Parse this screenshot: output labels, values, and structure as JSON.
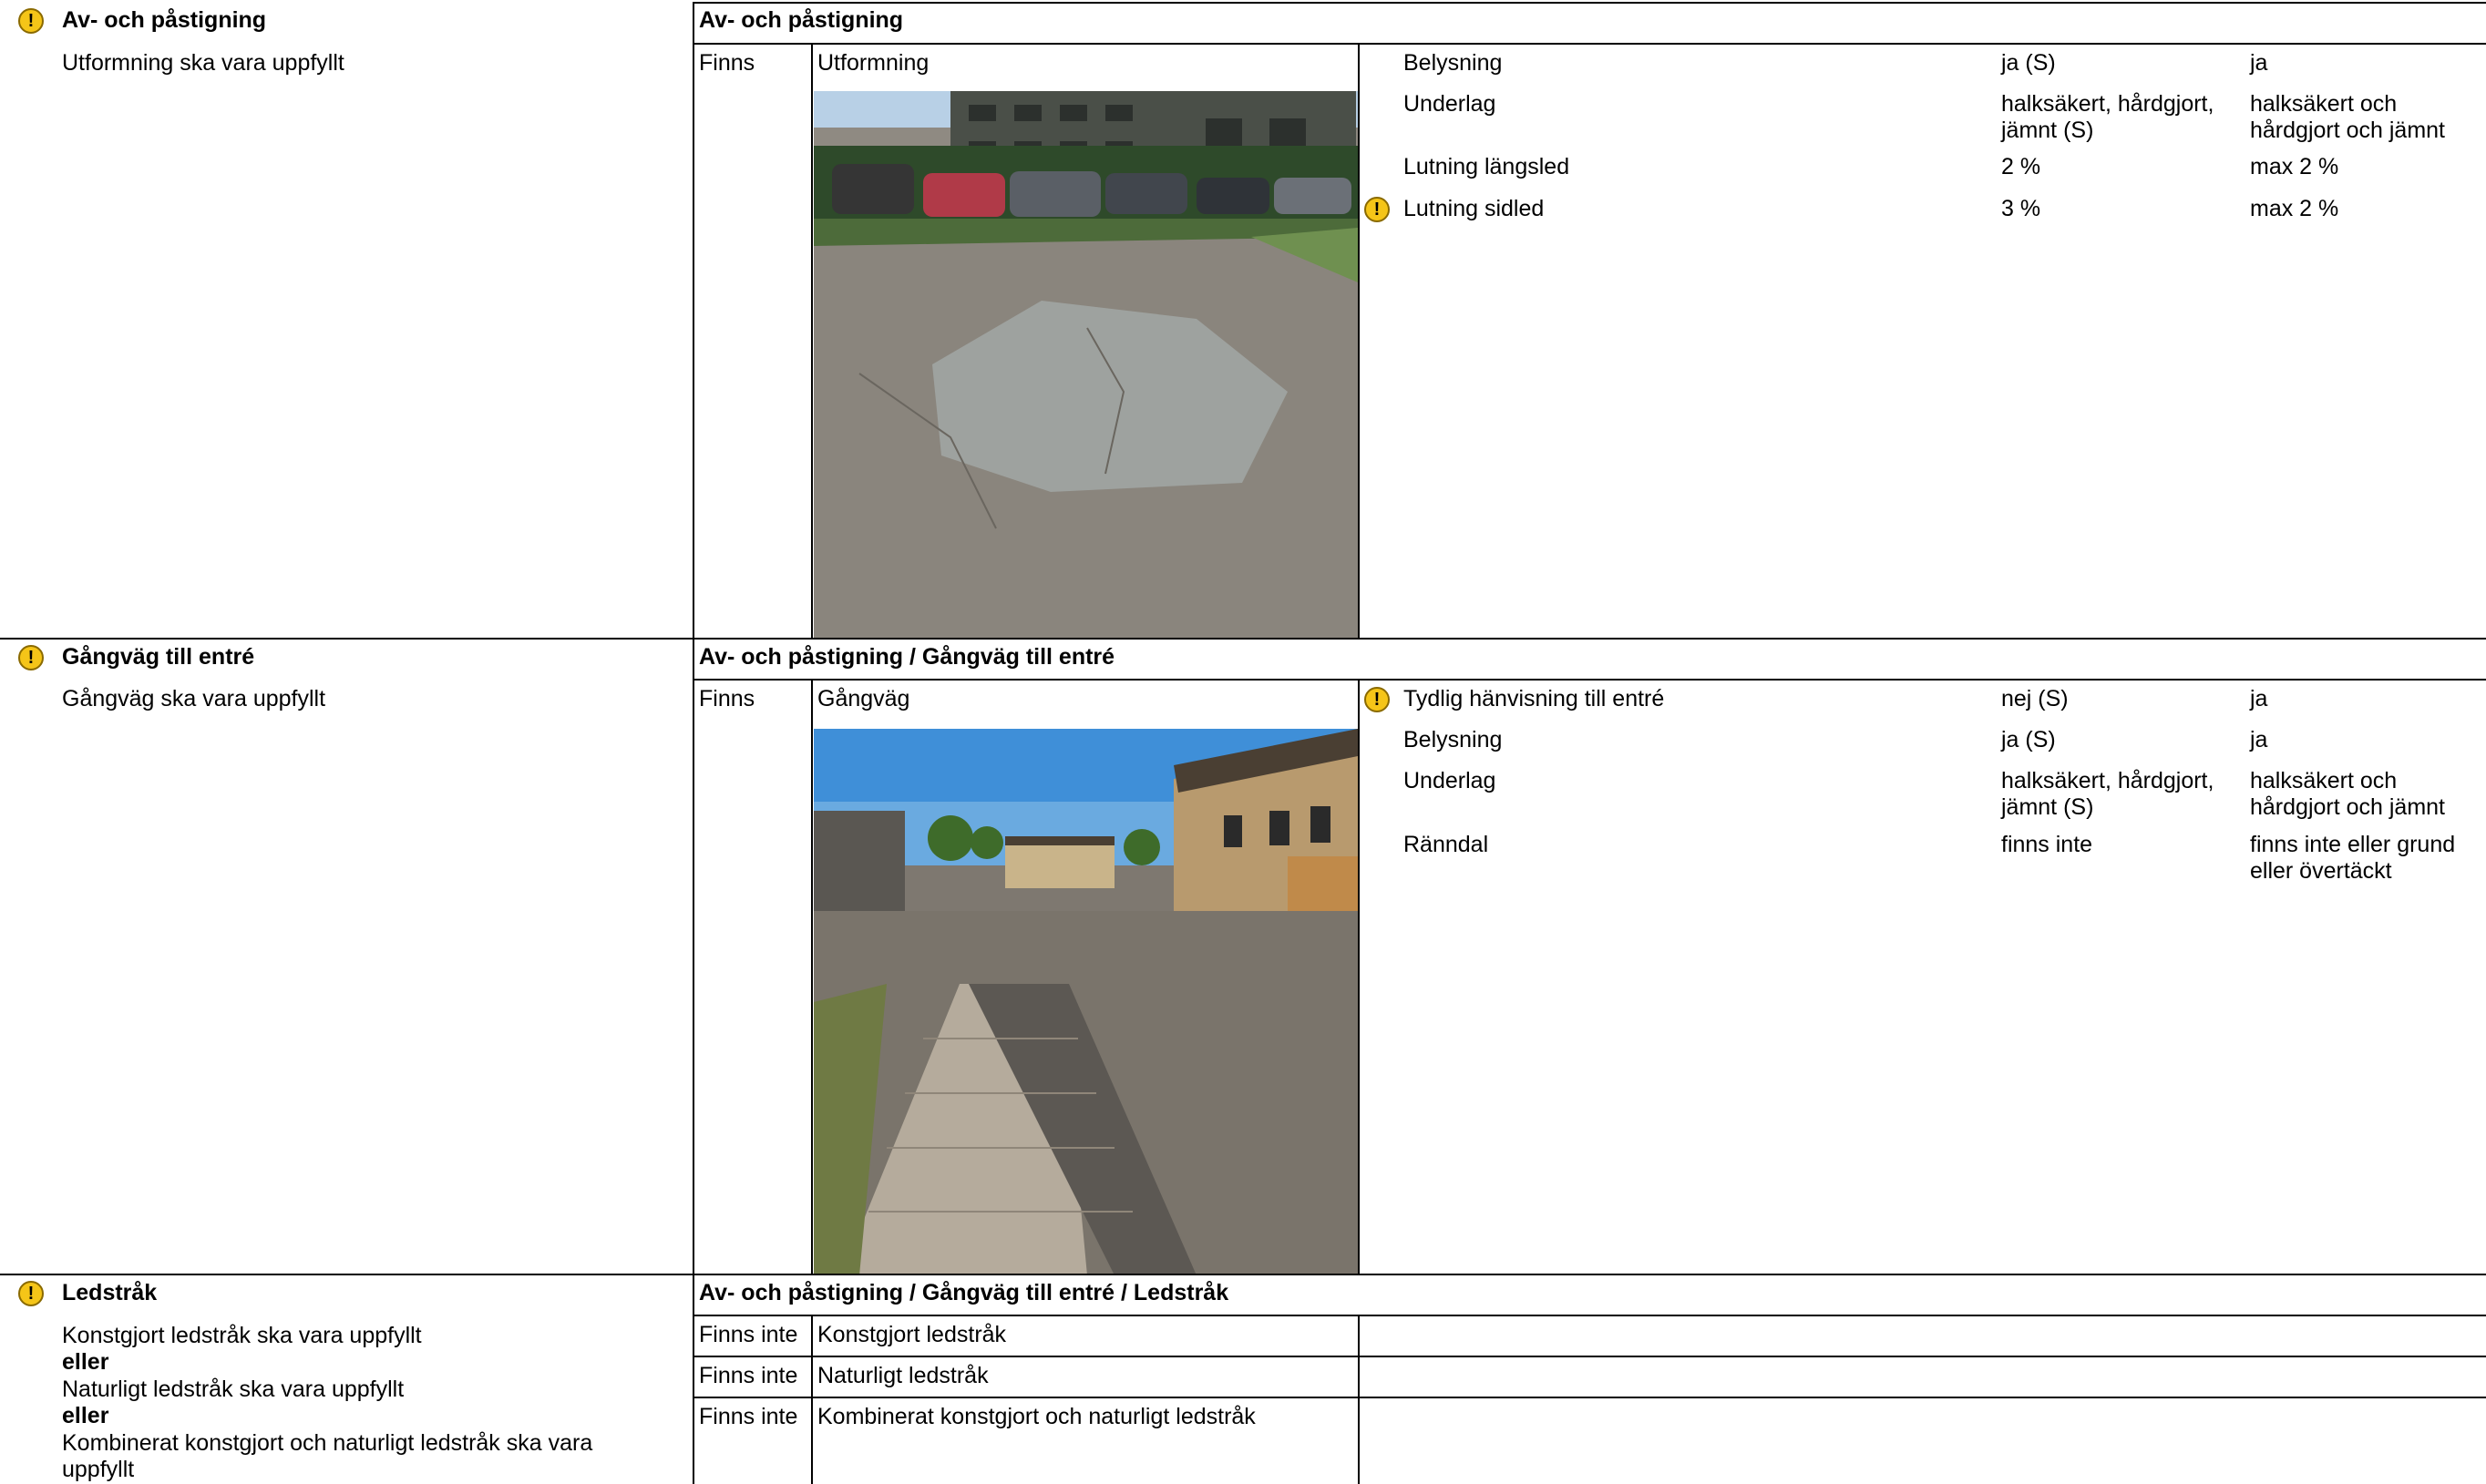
{
  "sections": [
    {
      "title": "Av- och påstigning",
      "requirement": "Utformning ska vara uppfyllt",
      "path": "Av- och påstigning",
      "rows": [
        {
          "status": "Finns",
          "name": "Utformning",
          "photo": "photo-parking-area",
          "props": [
            {
              "label": "Belysning",
              "value": "ja (S)",
              "req": "ja",
              "warn": false
            },
            {
              "label": "Underlag",
              "value": "halksäkert, hårdgjort, jämnt (S)",
              "req": "halksäkert och hårdgjort och jämnt",
              "warn": false
            },
            {
              "label": "Lutning längsled",
              "value": "2 %",
              "req": "max 2 %",
              "warn": false
            },
            {
              "label": "Lutning sidled",
              "value": "3 %",
              "req": "max 2 %",
              "warn": true
            }
          ]
        }
      ]
    },
    {
      "title": "Gångväg till entré",
      "requirement": "Gångväg ska vara uppfyllt",
      "path": "Av- och påstigning / Gångväg till entré",
      "rows": [
        {
          "status": "Finns",
          "name": "Gångväg",
          "photo": "photo-walkway",
          "props": [
            {
              "label": "Tydlig hänvisning till entré",
              "value": "nej (S)",
              "req": "ja",
              "warn": true
            },
            {
              "label": "Belysning",
              "value": "ja (S)",
              "req": "ja",
              "warn": false
            },
            {
              "label": "Underlag",
              "value": "halksäkert, hårdgjort, jämnt (S)",
              "req": "halksäkert och hårdgjort och jämnt",
              "warn": false
            },
            {
              "label": "Ränndal",
              "value": "finns inte",
              "req": "finns inte eller grund eller övertäckt",
              "warn": false
            }
          ]
        }
      ]
    },
    {
      "title": "Ledstråk",
      "requirement_lines": [
        "Konstgjort ledstråk ska vara uppfyllt",
        "eller",
        "Naturligt ledstråk ska vara uppfyllt",
        "eller",
        "Kombinerat konstgjort och naturligt ledstråk ska vara uppfyllt"
      ],
      "path": "Av- och påstigning / Gångväg till entré / Ledstråk",
      "rows": [
        {
          "status": "Finns inte",
          "name": "Konstgjort ledstråk"
        },
        {
          "status": "Finns inte",
          "name": "Naturligt ledstråk"
        },
        {
          "status": "Finns inte",
          "name": "Kombinerat konstgjort och naturligt ledstråk"
        }
      ]
    }
  ],
  "colors": {
    "warning": "#f5c518",
    "border": "#000000"
  },
  "icons": {
    "warning": "warning-icon"
  }
}
